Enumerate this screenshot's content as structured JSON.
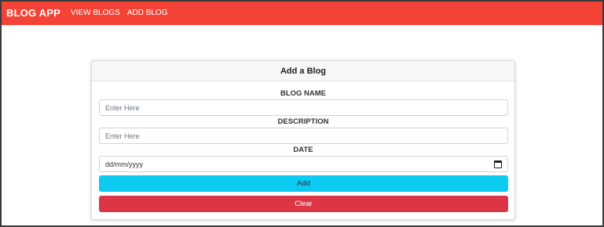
{
  "navbar": {
    "brand": "BLOG APP",
    "links": [
      "VIEW BLOGS",
      "ADD BLOG"
    ]
  },
  "card": {
    "title": "Add a Blog",
    "fields": [
      {
        "label": "BLOG NAME",
        "placeholder": "Enter Here"
      },
      {
        "label": "DESCRIPTION",
        "placeholder": "Enter Here"
      },
      {
        "label": "DATE",
        "placeholder": "dd/mm/yyyy"
      }
    ],
    "add_label": "Add",
    "clear_label": "Clear"
  },
  "colors": {
    "navbar": "#f44336",
    "add_button": "#0dcaf0",
    "clear_button": "#dc3545"
  }
}
